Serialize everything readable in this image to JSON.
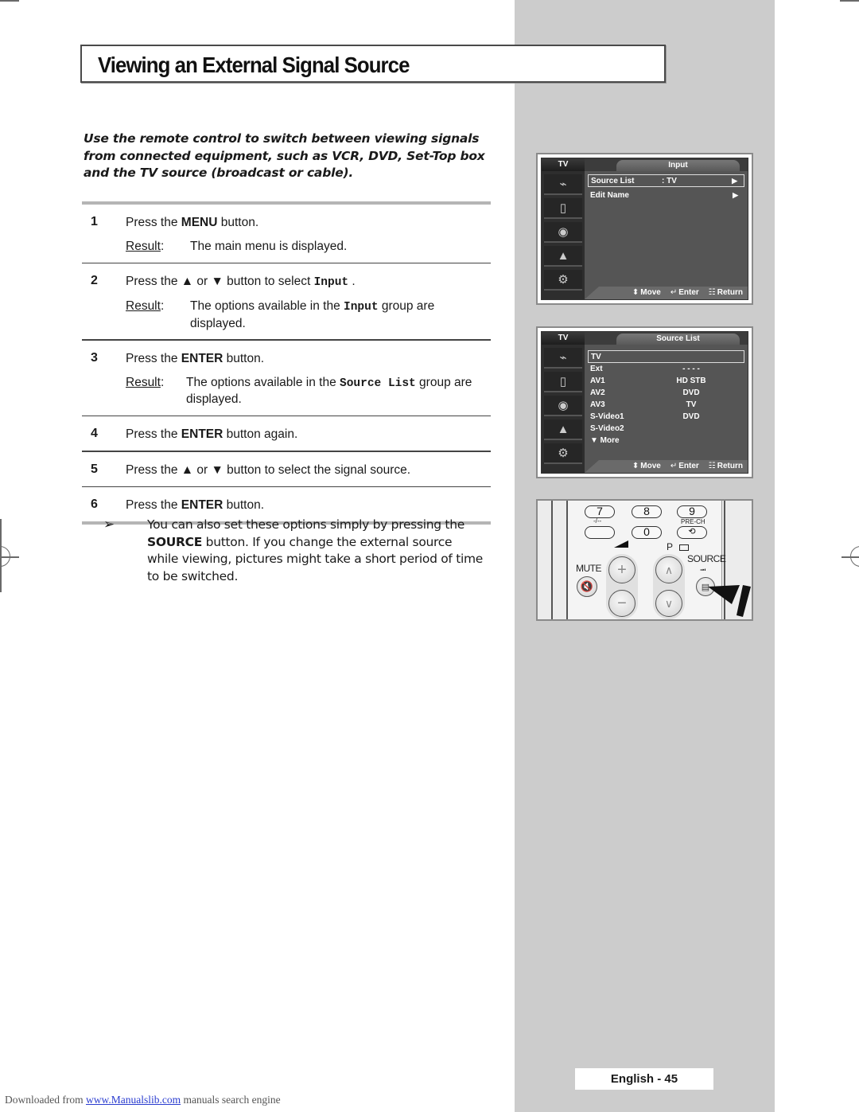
{
  "page": {
    "title": "Viewing an External Signal Source",
    "intro": "Use the remote control to switch between viewing signals from connected equipment, such as VCR, DVD, Set-Top box and the TV source (broadcast or cable).",
    "result_label": "Result",
    "steps": [
      {
        "num": "1",
        "pre": "Press the ",
        "bold": "MENU",
        "post": " button.",
        "result": "The main menu is displayed."
      },
      {
        "num": "2",
        "pre": "Press the ▲ or ▼ button to select ",
        "mono": "Input",
        "post": " .",
        "result_pre": "The options available in the ",
        "result_mono": "Input",
        "result_post": " group are displayed."
      },
      {
        "num": "3",
        "pre": "Press the ",
        "bold": "ENTER",
        "post": " button.",
        "result_pre": "The options available in the ",
        "result_mono": "Source List",
        "result_post": " group are displayed."
      },
      {
        "num": "4",
        "pre": "Press the ",
        "bold": "ENTER",
        "post": " button again."
      },
      {
        "num": "5",
        "pre": "Press the ▲ or ▼ button to select the signal source."
      },
      {
        "num": "6",
        "pre": "Press the ",
        "bold": "ENTER",
        "post": " button."
      }
    ],
    "note": {
      "arrow": "➢",
      "pre": "You can also set these options simply by pressing the ",
      "bold": "SOURCE",
      "post": " button. If you change the external source while viewing, pictures might take a short period of time to be switched."
    },
    "page_number": "English - 45"
  },
  "osd_input": {
    "tab": "TV",
    "title": "Input",
    "rows": [
      {
        "label": "Source List",
        "value": ": TV",
        "arrow": "▶",
        "selected": true
      },
      {
        "label": "Edit Name",
        "value": "",
        "arrow": "▶",
        "selected": false
      }
    ],
    "footer": {
      "move": "Move",
      "enter": "Enter",
      "return": "Return"
    }
  },
  "osd_source": {
    "tab": "TV",
    "title": "Source List",
    "rows": [
      {
        "label": "TV",
        "value": "",
        "selected": true
      },
      {
        "label": "Ext",
        "value": "- - - -"
      },
      {
        "label": "AV1",
        "value": "HD STB"
      },
      {
        "label": "AV2",
        "value": "DVD"
      },
      {
        "label": "AV3",
        "value": "TV"
      },
      {
        "label": "S-Video1",
        "value": "DVD"
      },
      {
        "label": "S-Video2",
        "value": ""
      },
      {
        "label": "▼  More",
        "value": ""
      }
    ],
    "footer": {
      "move": "Move",
      "enter": "Enter",
      "return": "Return"
    }
  },
  "remote": {
    "keys": {
      "k7": "7",
      "k8": "8",
      "k9": "9",
      "k0": "0"
    },
    "labels": {
      "dash": "-/--",
      "prech": "PRE-CH",
      "mute": "MUTE",
      "p": "P",
      "source": "SOURCE"
    }
  },
  "download": {
    "pre": "Downloaded from ",
    "link": "www.Manualslib.com",
    "post": "  manuals search engine"
  }
}
